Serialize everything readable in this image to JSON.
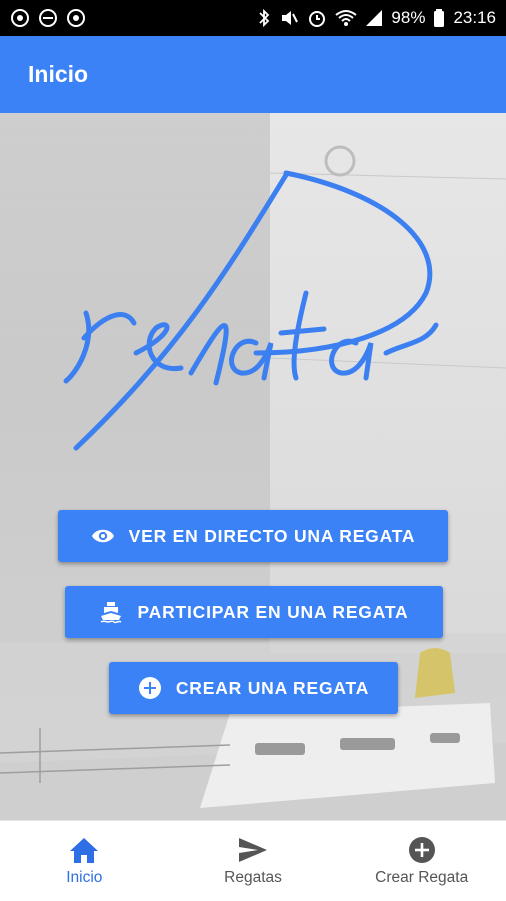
{
  "status_bar": {
    "battery": "98%",
    "time": "23:16",
    "left_icons": [
      "whatsapp-icon",
      "minus-circle-icon",
      "whatsapp-icon"
    ],
    "right_icons": [
      "bluetooth-icon",
      "mute-icon",
      "alarm-icon",
      "wifi-icon",
      "signal-icon",
      "battery-icon"
    ]
  },
  "appbar": {
    "title": "Inicio"
  },
  "logo": {
    "text": "regata"
  },
  "buttons": {
    "live": "VER EN DIRECTO UNA REGATA",
    "participate": "PARTICIPAR EN UNA REGATA",
    "create": "CREAR UNA REGATA"
  },
  "bottom_nav": [
    {
      "label": "Inicio",
      "icon": "home-icon",
      "active": true
    },
    {
      "label": "Regatas",
      "icon": "send-icon",
      "active": false
    },
    {
      "label": "Crear Regata",
      "icon": "add-circle-icon",
      "active": false
    }
  ],
  "colors": {
    "primary": "#3b82f6",
    "active_nav": "#2f6fe5",
    "inactive_nav": "#555555"
  }
}
